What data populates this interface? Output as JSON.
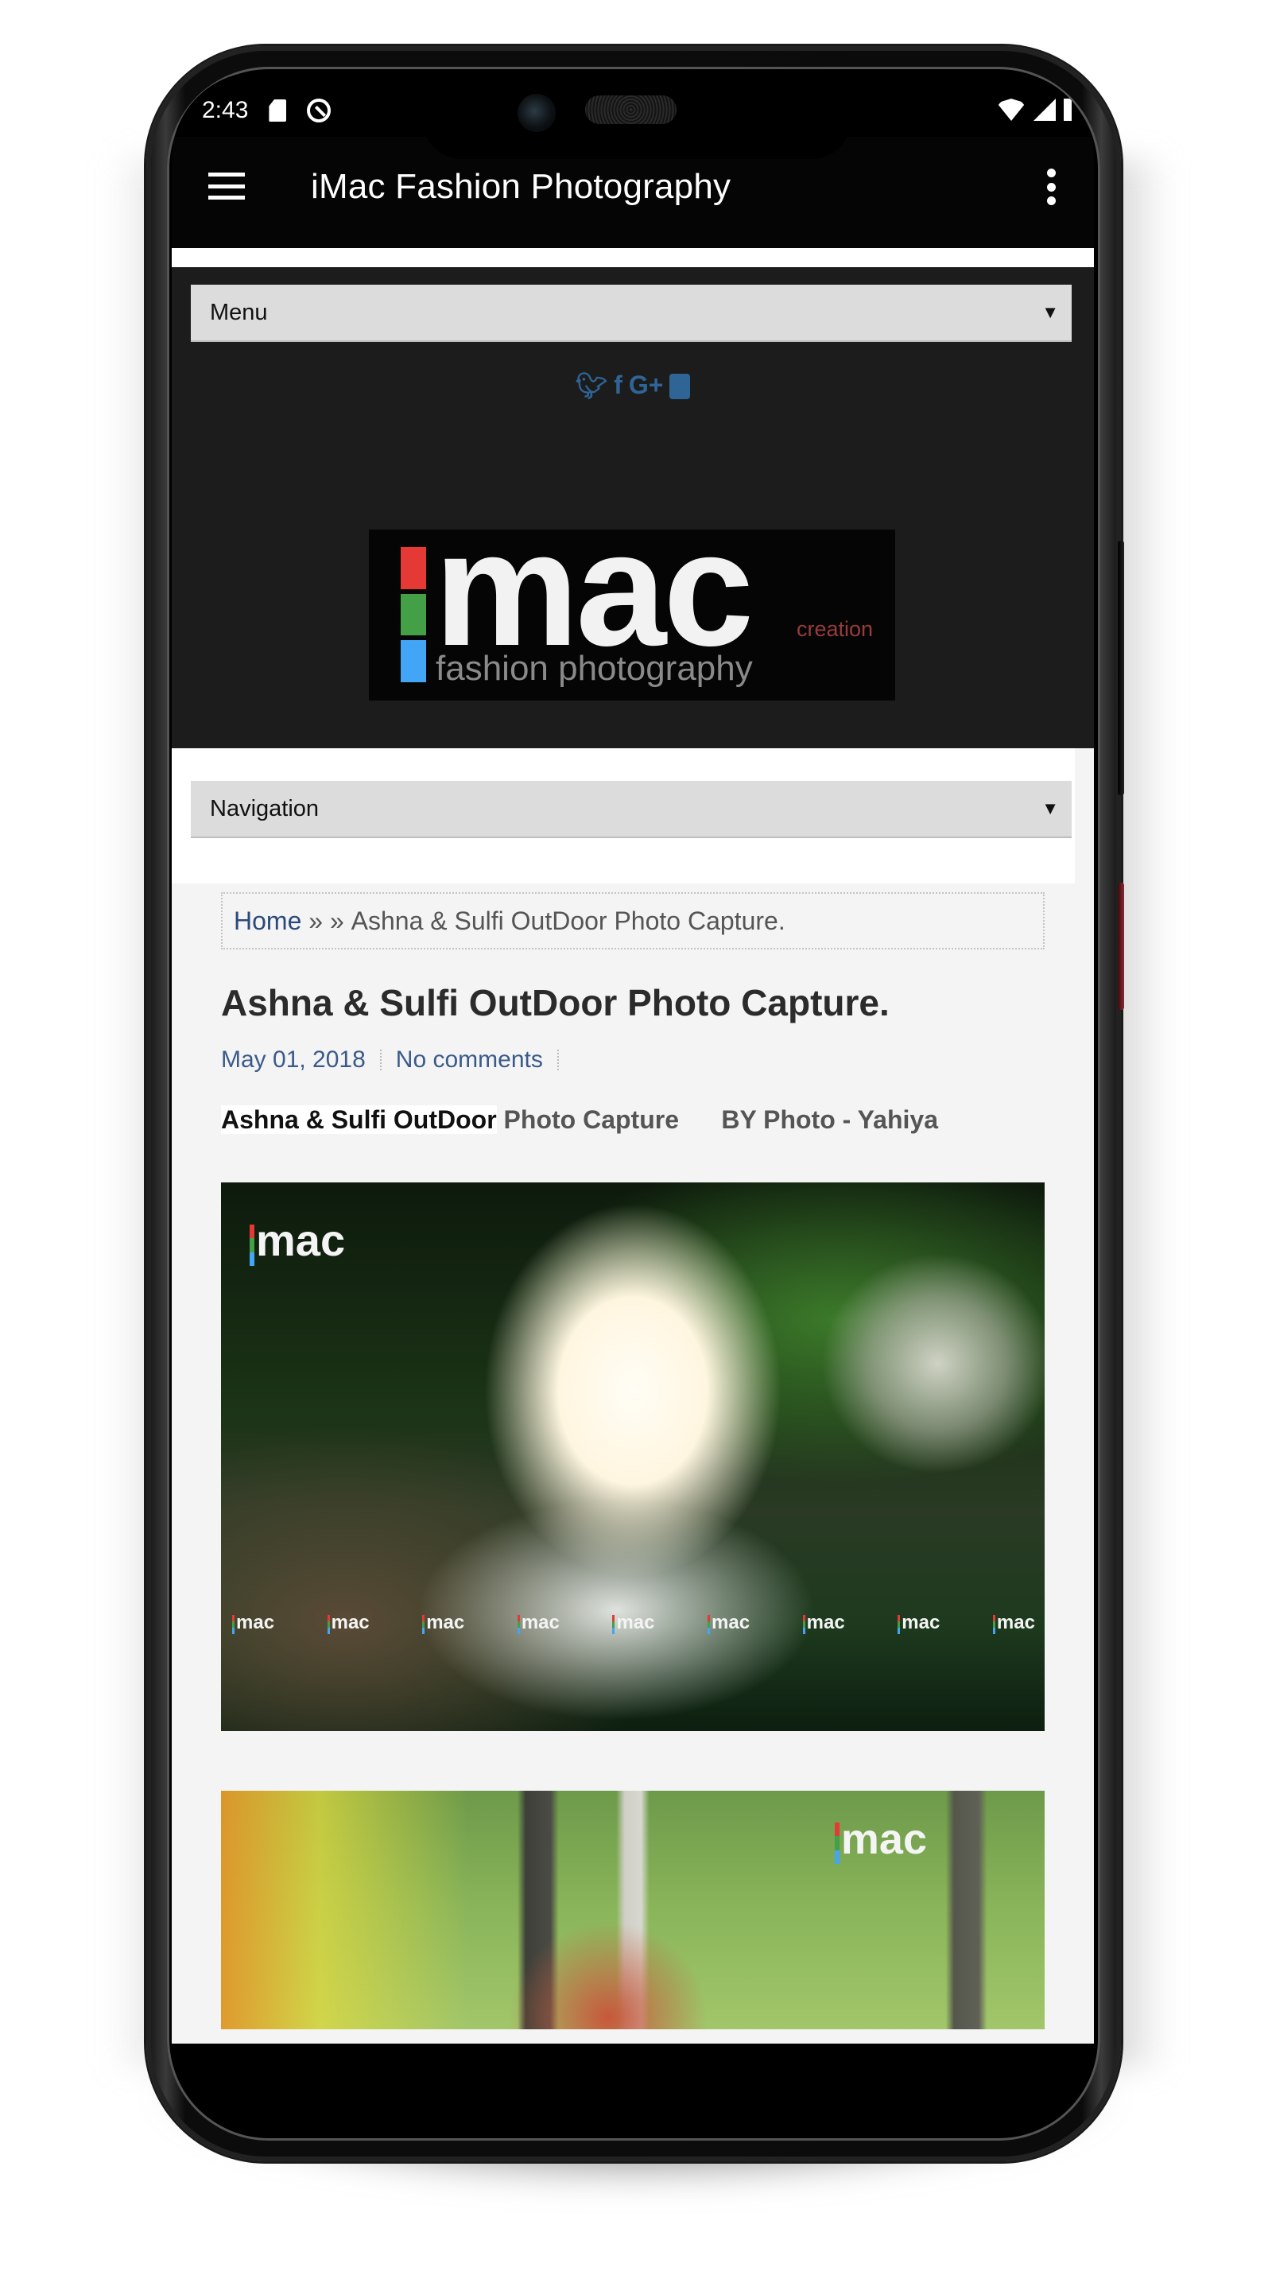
{
  "status_bar": {
    "time": "2:43",
    "left_icons": [
      "sd-card-icon",
      "data-saver-icon"
    ],
    "right_icons": [
      "wifi-icon",
      "signal-icon",
      "battery-icon"
    ]
  },
  "app_bar": {
    "title": "iMac Fashion Photography",
    "menu_icon": "hamburger-icon",
    "overflow_icon": "more-vert-icon"
  },
  "site": {
    "menu_dropdown": {
      "label": "Menu",
      "caret": "▼"
    },
    "social_icons": [
      {
        "name": "twitter-icon",
        "glyph": "🐦"
      },
      {
        "name": "facebook-icon",
        "glyph": "f"
      },
      {
        "name": "google-plus-icon",
        "glyph": "G+"
      },
      {
        "name": "youtube-icon",
        "glyph": ""
      }
    ],
    "logo": {
      "main": "mac",
      "creation": "creation",
      "subtitle": "fashion photography",
      "bar_colors": [
        "#e53935",
        "#43a047",
        "#42a5f5"
      ]
    },
    "nav_dropdown": {
      "label": "Navigation",
      "caret": "▼"
    }
  },
  "post": {
    "breadcrumb": {
      "home": "Home",
      "separator": " » » ",
      "current": "Ashna & Sulfi OutDoor Photo Capture."
    },
    "title": "Ashna & Sulfi OutDoor Photo Capture.",
    "date": "May 01, 2018",
    "comments": "No comments",
    "byline_strong": "Ashna & Sulfi OutDoor",
    "byline_rest": " Photo Capture      BY Photo - Yahiya",
    "photos": [
      {
        "watermark": "mac",
        "watermark_row": [
          "mac",
          "mac",
          "mac",
          "mac",
          "mac",
          "mac",
          "mac",
          "mac",
          "mac"
        ]
      },
      {
        "watermark": "mac"
      }
    ]
  },
  "nav_bar": {
    "back": "back-icon",
    "home": "home-icon",
    "recents": "recents-icon"
  },
  "colors": {
    "link": "#2b4a7a",
    "social": "#2f6596",
    "header_bg": "#1c1c1c",
    "dropdown_bg": "#dcdcdc"
  }
}
